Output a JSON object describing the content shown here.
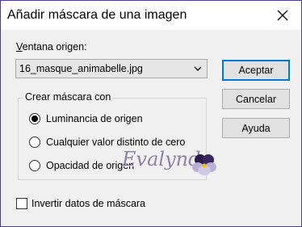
{
  "window": {
    "title": "Añadir máscara de una imagen"
  },
  "source": {
    "label": "Ventana origen:",
    "selected": "16_masque_animabelle.jpg"
  },
  "buttons": {
    "ok": "Aceptar",
    "cancel": "Cancelar",
    "help": "Ayuda"
  },
  "mask_group": {
    "label": "Crear máscara con",
    "options": [
      {
        "label": "Luminancia de origen",
        "checked": true
      },
      {
        "label": "Cualquier valor distinto de cero",
        "checked": false
      },
      {
        "label": "Opacidad de origen",
        "checked": false
      }
    ]
  },
  "invert": {
    "label": "Invertir datos de máscara",
    "checked": false
  },
  "watermark": "Evalynda",
  "colors": {
    "accent": "#0078d7",
    "border": "#4a3f86"
  }
}
